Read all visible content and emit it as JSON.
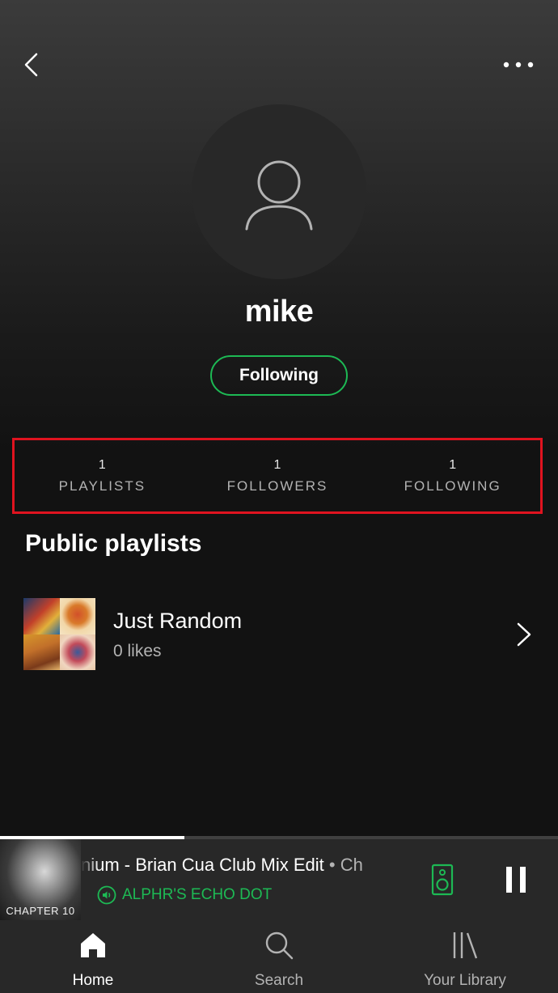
{
  "profile": {
    "username": "mike",
    "follow_button_label": "Following"
  },
  "stats": [
    {
      "count": "1",
      "label": "PLAYLISTS"
    },
    {
      "count": "1",
      "label": "FOLLOWERS"
    },
    {
      "count": "1",
      "label": "FOLLOWING"
    }
  ],
  "section": {
    "title": "Public playlists"
  },
  "playlists": [
    {
      "name": "Just Random",
      "subtitle": "0 likes"
    }
  ],
  "now_playing": {
    "track_title": "nium - Brian Cua Club Mix Edit",
    "separator": " • ",
    "track_artist": "Ch",
    "device": "ALPHR'S ECHO DOT",
    "album_art_text": "CHAPTER 10",
    "progress": 0.33
  },
  "tabs": [
    {
      "label": "Home",
      "icon": "home-icon",
      "active": true
    },
    {
      "label": "Search",
      "icon": "search-icon",
      "active": false
    },
    {
      "label": "Your Library",
      "icon": "library-icon",
      "active": false
    }
  ],
  "colors": {
    "accent_green": "#1db954",
    "highlight_red": "#e0131f",
    "background": "#121212"
  }
}
